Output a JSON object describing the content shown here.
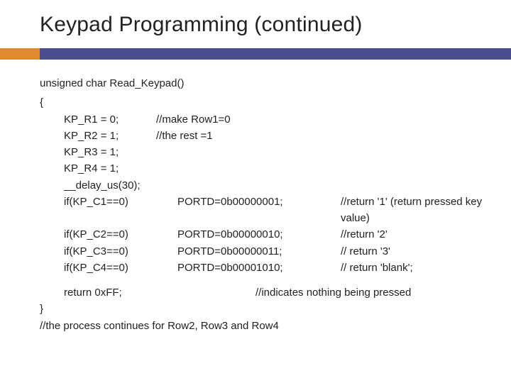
{
  "title": "Keypad Programming (continued)",
  "code": {
    "fn_sig": "unsigned char Read_Keypad()",
    "open_brace": "{",
    "rows_init": [
      {
        "stmt": "KP_R1 = 0;",
        "comment": "//make Row1=0"
      },
      {
        "stmt": "KP_R2 = 1;",
        "comment": "//the rest =1"
      },
      {
        "stmt": "KP_R3 = 1;",
        "comment": ""
      },
      {
        "stmt": "KP_R4 = 1;",
        "comment": ""
      }
    ],
    "delay": "__delay_us(30);",
    "checks": [
      {
        "cond": "if(KP_C1==0)",
        "assign": "PORTD=0b00000001;",
        "comment": "//return '1' (return pressed key value)"
      },
      {
        "cond": "if(KP_C2==0)",
        "assign": "PORTD=0b00000010;",
        "comment": "//return '2'"
      },
      {
        "cond": "if(KP_C3==0)",
        "assign": "PORTD=0b00000011;",
        "comment": "// return '3'"
      },
      {
        "cond": "if(KP_C4==0)",
        "assign": "PORTD=0b00001010;",
        "comment": "// return 'blank';"
      }
    ],
    "return_stmt": "return 0xFF;",
    "return_comment": "//indicates nothing being pressed",
    "close_brace": "}",
    "footer_note": "//the process continues for Row2, Row3 and Row4"
  }
}
